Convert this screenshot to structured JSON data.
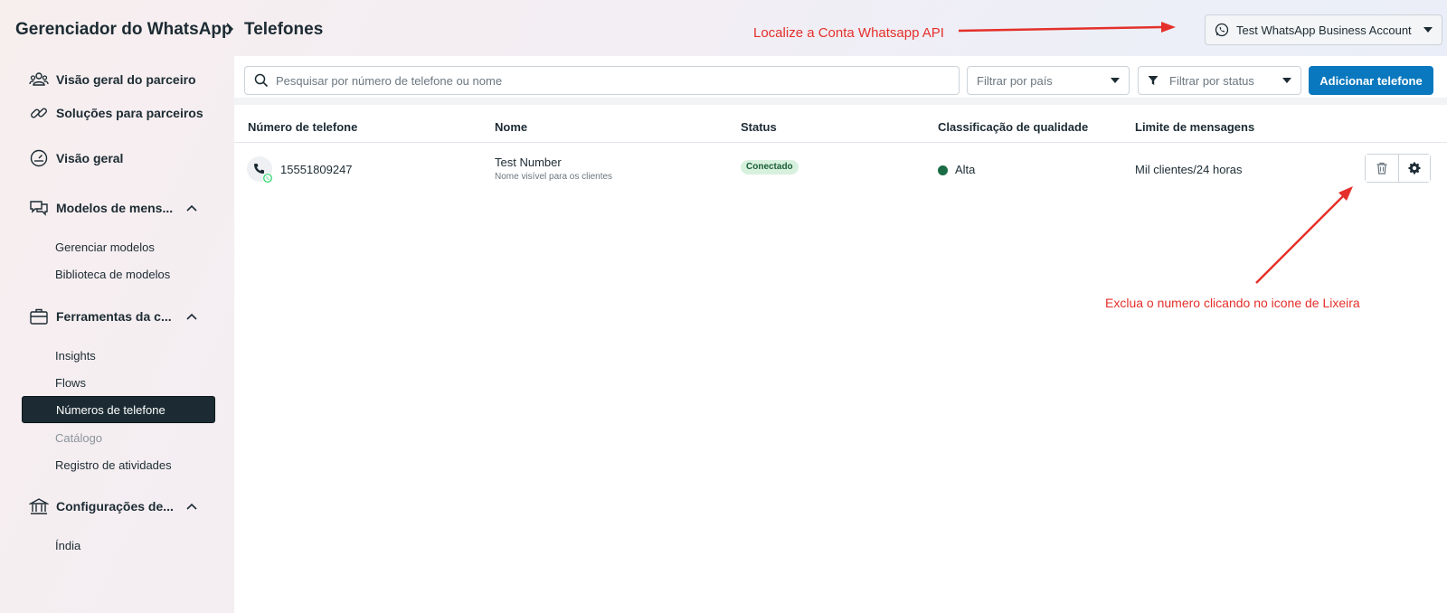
{
  "breadcrumb": {
    "root": "Gerenciador do WhatsApp",
    "current": "Telefones"
  },
  "account": {
    "label": "Test WhatsApp Business Account"
  },
  "annotations": {
    "top": "Localize a Conta Whatsapp API",
    "right": "Exclua o numero clicando no icone de Lixeira"
  },
  "sidebar": {
    "partner_overview": "Visão geral do parceiro",
    "partner_solutions": "Soluções para parceiros",
    "overview": "Visão geral",
    "templates": {
      "label": "Modelos de mens...",
      "items": [
        "Gerenciar modelos",
        "Biblioteca de modelos"
      ]
    },
    "account_tools": {
      "label": "Ferramentas da c...",
      "items": [
        "Insights",
        "Flows",
        "Números de telefone",
        "Catálogo",
        "Registro de atividades"
      ]
    },
    "settings": {
      "label": "Configurações de...",
      "items": [
        "Índia"
      ]
    }
  },
  "filters": {
    "search_placeholder": "Pesquisar por número de telefone ou nome",
    "country": "Filtrar por país",
    "status": "Filtrar por status",
    "add_button": "Adicionar telefone"
  },
  "table": {
    "headers": [
      "Número de telefone",
      "Nome",
      "Status",
      "Classificação de qualidade",
      "Limite de mensagens"
    ],
    "rows": [
      {
        "phone": "15551809247",
        "name": "Test Number",
        "name_sub": "Nome visível para os clientes",
        "status": "Conectado",
        "quality": "Alta",
        "limit": "Mil clientes/24 horas"
      }
    ]
  },
  "colors": {
    "primary": "#0a78be",
    "annotation": "#e4302b",
    "active_nav": "#1c2b33",
    "quality_high": "#1a6c45"
  },
  "icons": [
    "whatsapp-icon",
    "chevron-right-icon",
    "caret-down-icon",
    "people-icon",
    "link-icon",
    "gauge-icon",
    "chat-icon",
    "briefcase-icon",
    "bank-icon",
    "search-icon",
    "filter-icon",
    "phone-icon",
    "trash-icon",
    "gear-icon"
  ]
}
